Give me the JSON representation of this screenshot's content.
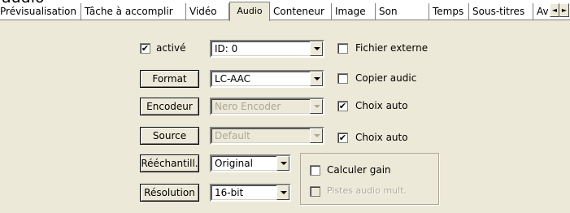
{
  "window": {
    "clipped_title": "audio"
  },
  "tabs": [
    {
      "label": "Prévisualisation",
      "active": false
    },
    {
      "label": "Tâche à accomplir",
      "active": false
    },
    {
      "label": "Vidéo",
      "active": false
    },
    {
      "label": "Audio",
      "active": true
    },
    {
      "label": "Conteneur",
      "active": false
    },
    {
      "label": "Image",
      "active": false
    },
    {
      "label": "Son",
      "active": false
    },
    {
      "label": "Temps",
      "active": false
    },
    {
      "label": "Sous-titres",
      "active": false
    },
    {
      "label": "Av",
      "active": false
    }
  ],
  "tab_scroll": {
    "left_icon": "◄",
    "right_icon": "►"
  },
  "audio": {
    "enabled": {
      "label": "activé",
      "checked": true
    },
    "track": {
      "value": "ID: 0",
      "disabled": false
    },
    "external_file": {
      "label": "Fichier externe",
      "checked": false
    },
    "format": {
      "button": "Format",
      "value": "LC-AAC",
      "disabled": false
    },
    "copy_audio": {
      "label": "Copier audic",
      "checked": false
    },
    "encoder": {
      "button": "Encodeur",
      "value": "Nero Encoder",
      "disabled": true
    },
    "encoder_auto": {
      "label": "Choix auto",
      "checked": true
    },
    "source": {
      "button": "Source",
      "value": "Default",
      "disabled": true
    },
    "source_auto": {
      "label": "Choix auto",
      "checked": true
    },
    "resample": {
      "button": "Rééchantill.",
      "value": "Original",
      "disabled": false
    },
    "resolution": {
      "button": "Résolution",
      "value": "16-bit",
      "disabled": false
    },
    "compute_gain": {
      "label": "Calculer gain",
      "checked": false
    },
    "multi_tracks": {
      "label": "Pistes audio mult.",
      "checked": false,
      "disabled": true
    }
  },
  "check_glyph": "✔"
}
